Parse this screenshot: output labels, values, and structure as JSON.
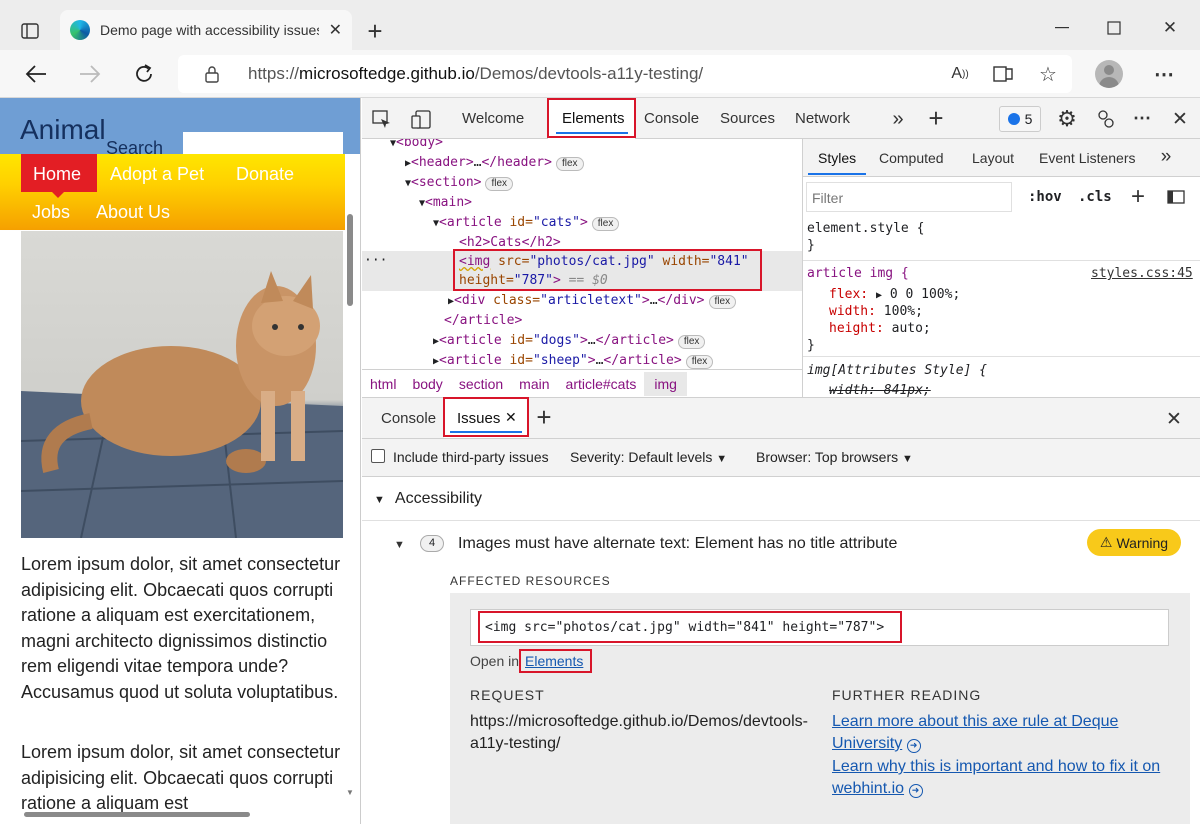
{
  "browser": {
    "tab_title": "Demo page with accessibility issues",
    "url_prefix": "https://",
    "url_domain": "microsoftedge.github.io",
    "url_path": "/Demos/devtools-a11y-testing/"
  },
  "page": {
    "logo": "Animal",
    "search": "Search",
    "nav": [
      "Home",
      "Adopt a Pet",
      "Donate",
      "Jobs",
      "About Us"
    ],
    "para1": "Lorem ipsum dolor, sit amet consectetur adipisicing elit. Obcaecati quos corrupti ratione a aliquam est exercitationem, magni architecto dignissimos distinctio rem eligendi vitae tempora unde? Accusamus quod ut soluta voluptatibus.",
    "para2": "Lorem ipsum dolor, sit amet consectetur adipisicing elit. Obcaecati quos corrupti ratione a aliquam est"
  },
  "devtools": {
    "tabs": [
      "Welcome",
      "Elements",
      "Console",
      "Sources",
      "Network"
    ],
    "active_tab": "Elements",
    "issue_count": "5",
    "dom": {
      "body": "<body>",
      "header_open": "<header>",
      "header_close": "</header>",
      "section": "<section>",
      "main": "<main>",
      "article": "<article",
      "id_attr": "id=",
      "cats_val": "\"cats\"",
      "h2": "<h2>Cats</h2>",
      "img_line1_tag": "<img",
      "src_attr": "src=",
      "src_val": "\"photos/cat.jpg\"",
      "width_attr": "width=",
      "width_val": "\"841\"",
      "height_attr": "height=",
      "height_val": "\"787\"",
      "gt": ">",
      "eq": "== $0",
      "div_open": "<div",
      "class_attr": "class=",
      "class_val": "\"articletext\"",
      "div_close": "</div>",
      "article_close": "</article>",
      "dogs_val": "\"dogs\"",
      "sheep_val": "\"sheep\"",
      "ellipsis": "…",
      "flex": "flex"
    },
    "breadcrumb": [
      "html",
      "body",
      "section",
      "main",
      "article#cats",
      "img"
    ],
    "styles_tabs": [
      "Styles",
      "Computed",
      "Layout",
      "Event Listeners"
    ],
    "filter_placeholder": "Filter",
    "hov": ":hov",
    "cls": ".cls",
    "rules": {
      "element_style": "element.style {",
      "close": "}",
      "article_img": "article img {",
      "source": "styles.css:45",
      "flex_prop": "flex:",
      "flex_val": "0 0 100%;",
      "width_prop": "width:",
      "width_val": "100%;",
      "height_prop": "height:",
      "height_val": "auto;",
      "attr_style": "img[Attributes Style] {",
      "struck": "width: 841px;"
    }
  },
  "drawer": {
    "tabs": [
      "Console",
      "Issues"
    ],
    "active": "Issues",
    "third_party": "Include third-party issues",
    "severity_label": "Severity:",
    "severity_value": "Default levels",
    "browser_label": "Browser:",
    "browser_value": "Top browsers",
    "category": "Accessibility",
    "issue_count": "4",
    "issue_title": "Images must have alternate text: Element has no title attribute",
    "warning": "Warning",
    "affected": "AFFECTED RESOURCES",
    "resource": "<img src=\"photos/cat.jpg\" width=\"841\" height=\"787\">",
    "open_in": "Open in",
    "elements_link": "Elements",
    "request_label": "REQUEST",
    "request_url": "https://microsoftedge.github.io/Demos/devtools-a11y-testing/",
    "further_label": "FURTHER READING",
    "link1": "Learn more about this axe rule at Deque University",
    "link2": "Learn why this is important and how to fix it on webhint.io"
  },
  "colors": {
    "nav_yellow": "#ffdd00",
    "nav_orange": "#f5a300",
    "home_red": "#e31e24",
    "header_blue": "#6f9ed4",
    "red_box": "#d8152a",
    "warning_bg": "#f8c91a"
  }
}
